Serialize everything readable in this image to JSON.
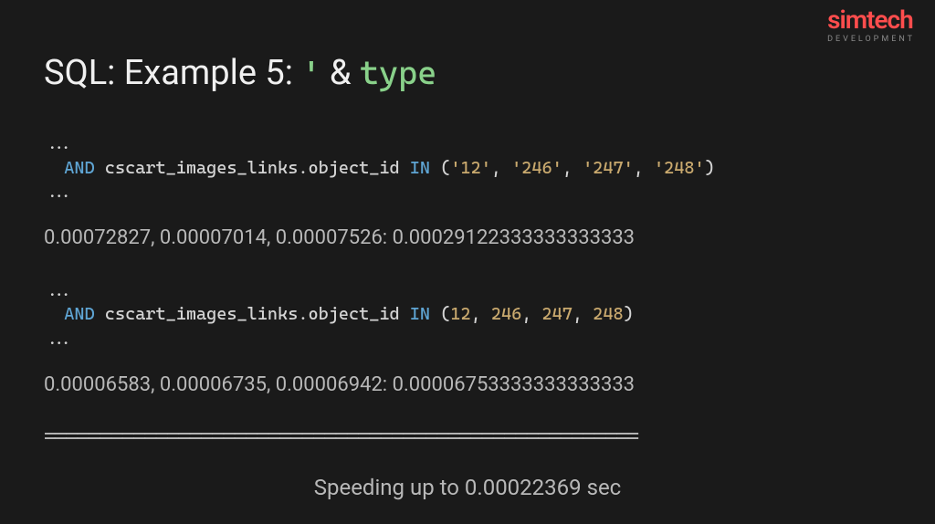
{
  "logo": {
    "main": "simtech",
    "sub": "DEVELOPMENT"
  },
  "title": {
    "prefix": "SQL: Example 5: ",
    "quote": "'",
    "amp": " & ",
    "type": "type"
  },
  "block1": {
    "ellipsis_top": "...",
    "and": "AND",
    "identifier": " cscart_images_links.object_id ",
    "in": "IN",
    "open": " (",
    "v1": "'12'",
    "v2": "'246'",
    "v3": "'247'",
    "v4": "'248'",
    "close": ")",
    "ellipsis_bottom": "..."
  },
  "timing1": "0.00072827, 0.00007014, 0.00007526: 0.00029122333333333333",
  "block2": {
    "ellipsis_top": "...",
    "and": "AND",
    "identifier": " cscart_images_links.object_id ",
    "in": "IN",
    "open": " (",
    "v1": "12",
    "v2": "246",
    "v3": "247",
    "v4": "248",
    "close": ")",
    "ellipsis_bottom": "..."
  },
  "timing2": "0.00006583, 0.00006735, 0.00006942: 0.00006753333333333333",
  "divider": "=====================================================",
  "summary": "Speeding up to 0.00022369 sec",
  "comma_sep": ", "
}
